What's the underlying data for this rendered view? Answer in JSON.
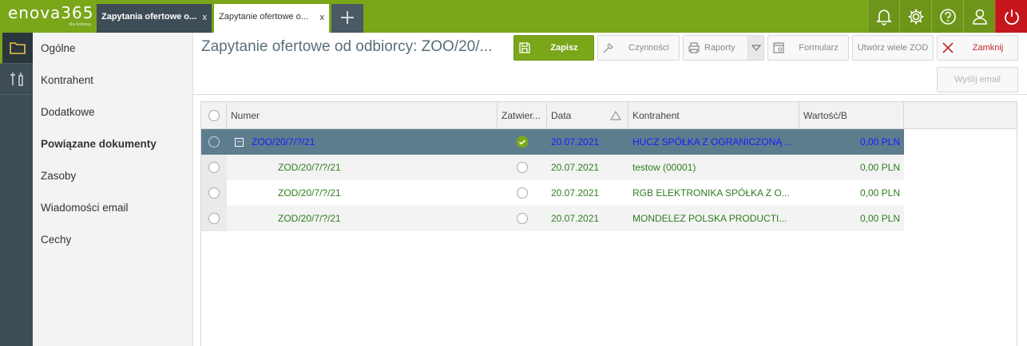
{
  "app": {
    "logo": "enova365",
    "logo_sub": "dla biznesu"
  },
  "tabs": [
    {
      "label": "Zapytania ofertowe o...",
      "close": "x"
    },
    {
      "label": "Zapytanie ofertowe o...",
      "close": "x"
    }
  ],
  "top_icons": [
    "bell-icon",
    "gear-icon",
    "help-icon",
    "user-icon",
    "power-icon"
  ],
  "sidebar": {
    "items": [
      {
        "label": "Ogólne"
      },
      {
        "label": "Kontrahent"
      },
      {
        "label": "Dodatkowe"
      },
      {
        "label": "Powiązane dokumenty"
      },
      {
        "label": "Zasoby"
      },
      {
        "label": "Wiadomości email"
      },
      {
        "label": "Cechy"
      }
    ]
  },
  "page": {
    "title": "Zapytanie ofertowe od odbiorcy: ZOO/20/..."
  },
  "toolbar": {
    "save": "Zapisz",
    "actions": "Czynności",
    "reports": "Raporty",
    "form": "Formularz",
    "create_many": "Utwórz wiele ZOD",
    "close": "Zamknij",
    "send_email": "Wyślij email"
  },
  "grid": {
    "columns": [
      "Numer",
      "Zatwier...",
      "Data",
      "Kontrahent",
      "Wartość/B"
    ],
    "rows": [
      {
        "numer": "ZOO/20/7/?/21",
        "approved": true,
        "data": "20.07.2021",
        "kontrahent": "HUCZ SPÓŁKA Z OGRANICZONĄ ...",
        "wartosc": "0,00 PLN",
        "expand": "−"
      },
      {
        "numer": "ZOD/20/7/?/21",
        "approved": false,
        "data": "20.07.2021",
        "kontrahent": "testow (00001)",
        "wartosc": "0,00 PLN"
      },
      {
        "numer": "ZOD/20/7/?/21",
        "approved": false,
        "data": "20.07.2021",
        "kontrahent": "RGB ELEKTRONIKA SPÓŁKA Z O...",
        "wartosc": "0,00 PLN"
      },
      {
        "numer": "ZOD/20/7/?/21",
        "approved": false,
        "data": "20.07.2021",
        "kontrahent": "MONDELEZ POLSKA PRODUCTI...",
        "wartosc": "0,00 PLN"
      }
    ]
  },
  "colors": {
    "brand": "#7aa61a",
    "selected_row": "#5d7d8f",
    "link_green": "#2e7d1f",
    "power": "#c5161d"
  }
}
